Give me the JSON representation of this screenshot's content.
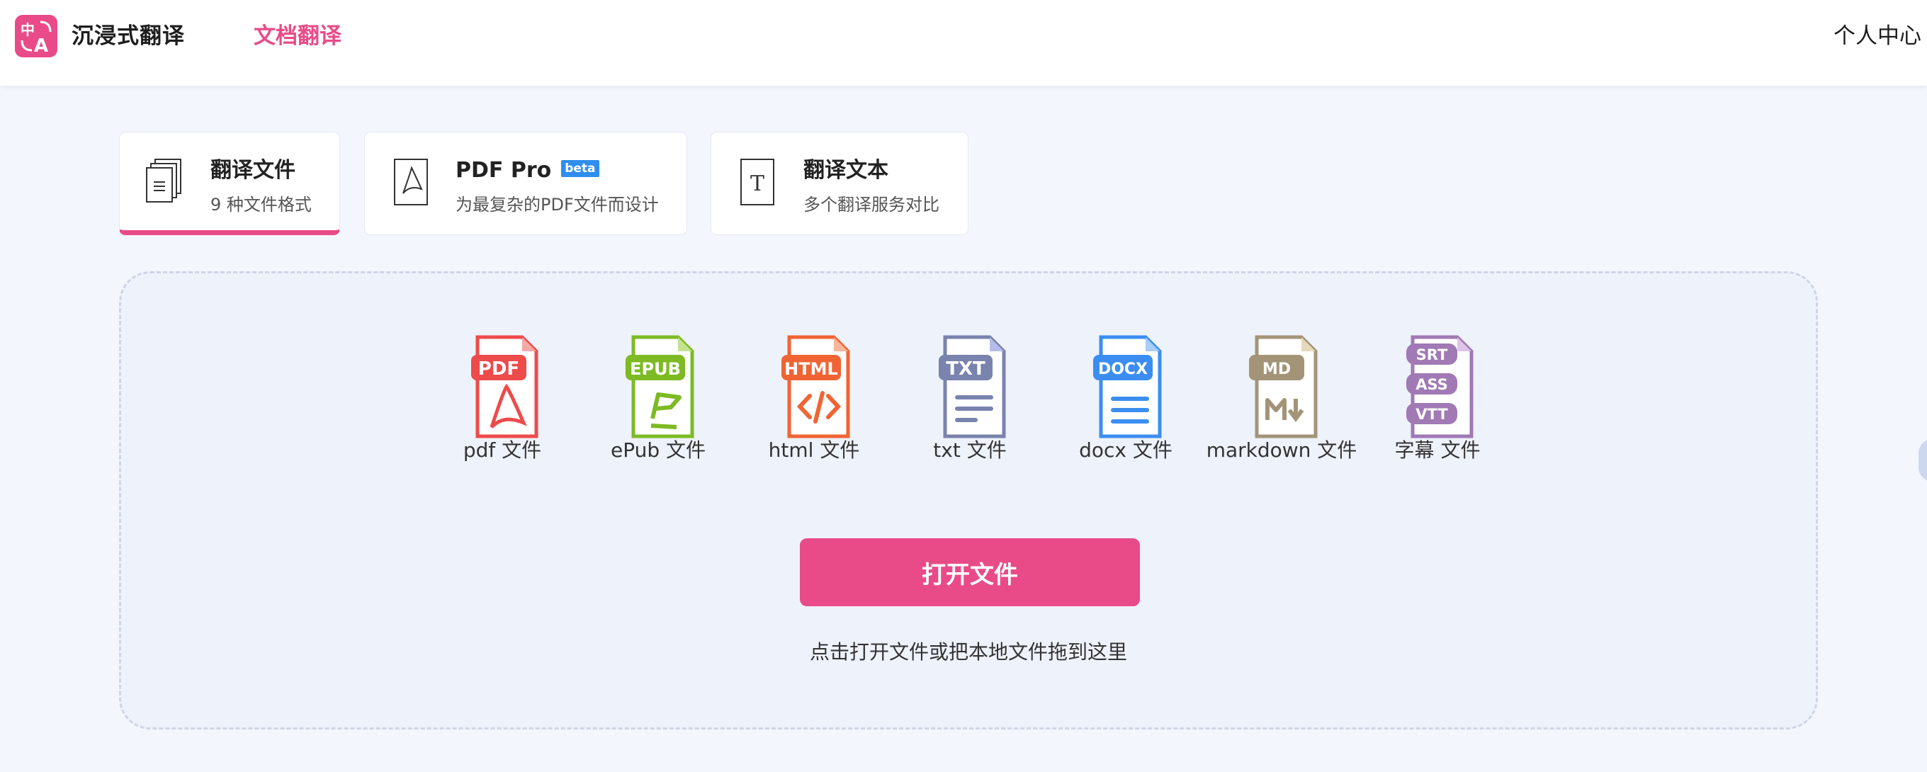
{
  "header": {
    "logo_text_top": "中",
    "logo_text_bottom": "A",
    "brand": "沉浸式翻译",
    "nav_doc": "文档翻译",
    "nav_user": "个人中心"
  },
  "tabs": [
    {
      "title": "翻译文件",
      "subtitle": "9 种文件格式",
      "active": true,
      "icon": "files-stack-icon"
    },
    {
      "title": "PDF Pro",
      "badge": "beta",
      "subtitle": "为最复杂的PDF文件而设计",
      "active": false,
      "icon": "pdf-document-icon"
    },
    {
      "title": "翻译文本",
      "subtitle": "多个翻译服务对比",
      "active": false,
      "icon": "text-document-icon"
    }
  ],
  "formats": [
    {
      "badge": "PDF",
      "label": "pdf 文件",
      "color": "#ee4b4b"
    },
    {
      "badge": "EPUB",
      "label": "ePub 文件",
      "color": "#7dba24"
    },
    {
      "badge": "HTML",
      "label": "html 文件",
      "color": "#f06434"
    },
    {
      "badge": "TXT",
      "label": "txt 文件",
      "color": "#7a83ad"
    },
    {
      "badge": "DOCX",
      "label": "docx 文件",
      "color": "#3b8ef0"
    },
    {
      "badge": "MD",
      "label": "markdown 文件",
      "color": "#a39478"
    },
    {
      "badges": [
        "SRT",
        "ASS",
        "VTT"
      ],
      "label": "字幕 文件",
      "color": "#a079b5"
    }
  ],
  "open_button": "打开文件",
  "hint": "点击打开文件或把本地文件拖到这里",
  "colors": {
    "accent": "#e94b88",
    "background": "#f3f6fd",
    "beta_badge": "#2f8dee"
  }
}
